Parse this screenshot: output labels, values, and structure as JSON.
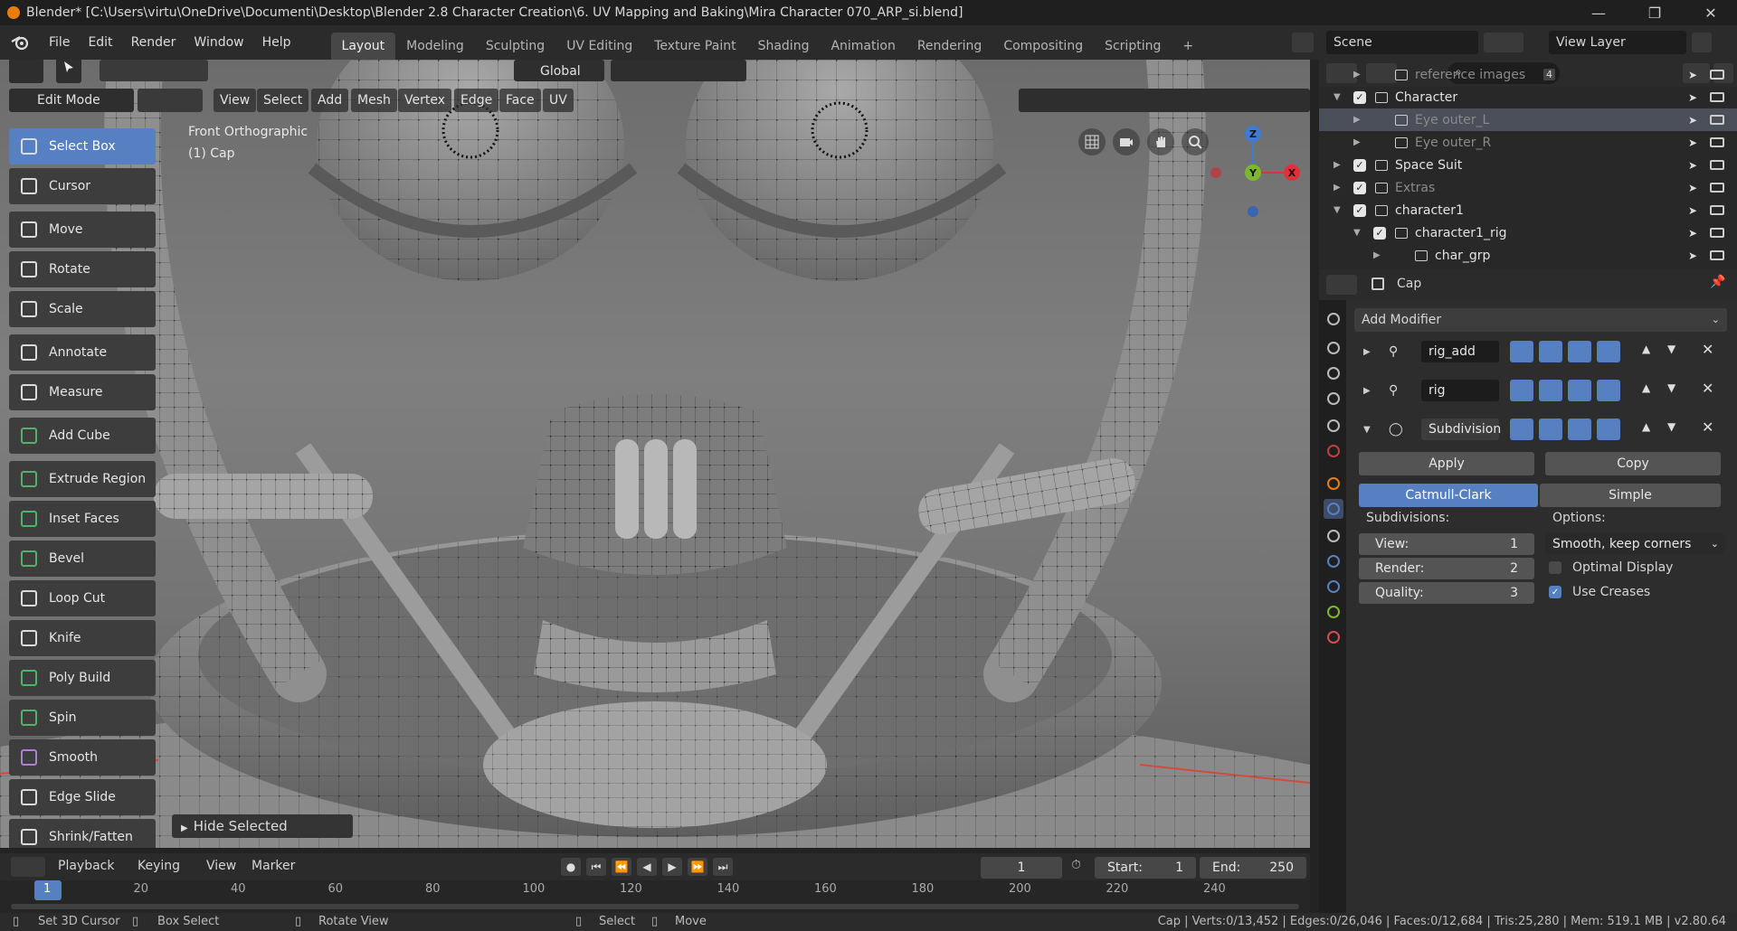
{
  "window": {
    "title": "Blender* [C:\\Users\\virtu\\OneDrive\\Documenti\\Desktop\\Blender 2.8 Character Creation\\6. UV Mapping and Baking\\Mira Character 070_ARP_si.blend]",
    "minimize": "—",
    "maximize": "❐",
    "close": "✕"
  },
  "menu": [
    "File",
    "Edit",
    "Render",
    "Window",
    "Help"
  ],
  "workspaces": [
    "Layout",
    "Modeling",
    "Sculpting",
    "UV Editing",
    "Texture Paint",
    "Shading",
    "Animation",
    "Rendering",
    "Compositing",
    "Scripting",
    "+"
  ],
  "scene": {
    "label": "Scene",
    "view_layer": "View Layer"
  },
  "viewport": {
    "transform_orientation": "Global",
    "mode": "Edit Mode",
    "header_menus": [
      "View",
      "Select",
      "Add",
      "Mesh",
      "Vertex",
      "Edge",
      "Face",
      "UV"
    ],
    "view_name": "Front Orthographic",
    "object_name": "(1) Cap",
    "last_op": "Hide Selected",
    "gizmo": {
      "z": "Z",
      "y": "Y",
      "x": "X"
    }
  },
  "tools": [
    "Select Box",
    "Cursor",
    "Move",
    "Rotate",
    "Scale",
    "Annotate",
    "Measure",
    "Add Cube",
    "Extrude Region",
    "Inset Faces",
    "Bevel",
    "Loop Cut",
    "Knife",
    "Poly Build",
    "Spin",
    "Smooth",
    "Edge Slide",
    "Shrink/Fatten"
  ],
  "outliner": {
    "rows": [
      {
        "label": "reference images",
        "count": "4"
      },
      {
        "label": "Character"
      },
      {
        "label": "Eye outer_L"
      },
      {
        "label": "Eye outer_R"
      },
      {
        "label": "Space Suit"
      },
      {
        "label": "Extras"
      },
      {
        "label": "character1"
      },
      {
        "label": "character1_rig"
      },
      {
        "label": "char_grp"
      }
    ]
  },
  "properties": {
    "object": "Cap",
    "add_modifier": "Add Modifier",
    "modifiers": [
      "rig_add",
      "rig",
      "Subdivision"
    ],
    "apply": "Apply",
    "copy": "Copy",
    "catmull": "Catmull-Clark",
    "simple": "Simple",
    "subdivisions_label": "Subdivisions:",
    "options_label": "Options:",
    "view_label": "View:",
    "view_value": "1",
    "render_label": "Render:",
    "render_value": "2",
    "quality_label": "Quality:",
    "quality_value": "3",
    "uv_smooth": "Smooth, keep corners",
    "optimal_display": "Optimal Display",
    "use_creases": "Use Creases"
  },
  "timeline": {
    "menus": [
      "Playback",
      "Keying",
      "View",
      "Marker"
    ],
    "current_frame": "1",
    "start_label": "Start:",
    "start": "1",
    "end_label": "End:",
    "end": "250",
    "ticks": [
      "1",
      "20",
      "40",
      "60",
      "80",
      "100",
      "120",
      "140",
      "160",
      "180",
      "200",
      "220",
      "240"
    ]
  },
  "status": {
    "set_cursor": "Set 3D Cursor",
    "box_select": "Box Select",
    "rotate_view": "Rotate View",
    "select": "Select",
    "move": "Move",
    "stats": "Cap | Verts:0/13,452 | Edges:0/26,046 | Faces:0/12,684 | Tris:25,280 | Mem: 519.1 MB | v2.80.64"
  },
  "colors": {
    "accent": "#5680c2",
    "orange": "#e87d0d",
    "axis_x": "#e0303a",
    "axis_y": "#7cb82d",
    "axis_z": "#3f7ad6"
  }
}
